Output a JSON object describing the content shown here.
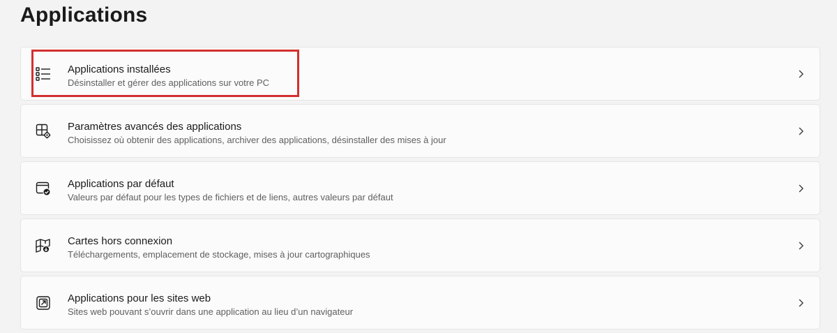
{
  "page": {
    "title": "Applications"
  },
  "settings_items": [
    {
      "icon": "installed-apps-list-icon",
      "title": "Applications installées",
      "subtitle": "Désinstaller et gérer des applications sur votre PC",
      "highlighted": true
    },
    {
      "icon": "advanced-app-settings-icon",
      "title": "Paramètres avancés des applications",
      "subtitle": "Choisissez où obtenir des applications, archiver des applications, désinstaller des mises à jour",
      "highlighted": false
    },
    {
      "icon": "default-apps-icon",
      "title": "Applications par défaut",
      "subtitle": "Valeurs par défaut pour les types de fichiers et de liens, autres valeurs par défaut",
      "highlighted": false
    },
    {
      "icon": "offline-maps-icon",
      "title": "Cartes hors connexion",
      "subtitle": "Téléchargements, emplacement de stockage, mises à jour cartographiques",
      "highlighted": false
    },
    {
      "icon": "apps-for-websites-icon",
      "title": "Applications pour les sites web",
      "subtitle": "Sites web pouvant s’ouvrir dans une application au lieu d’un navigateur",
      "highlighted": false
    }
  ],
  "colors": {
    "background": "#f3f3f3",
    "card_background": "#fbfbfb",
    "card_border": "#e5e5e5",
    "highlight_border": "#d32f2f"
  }
}
